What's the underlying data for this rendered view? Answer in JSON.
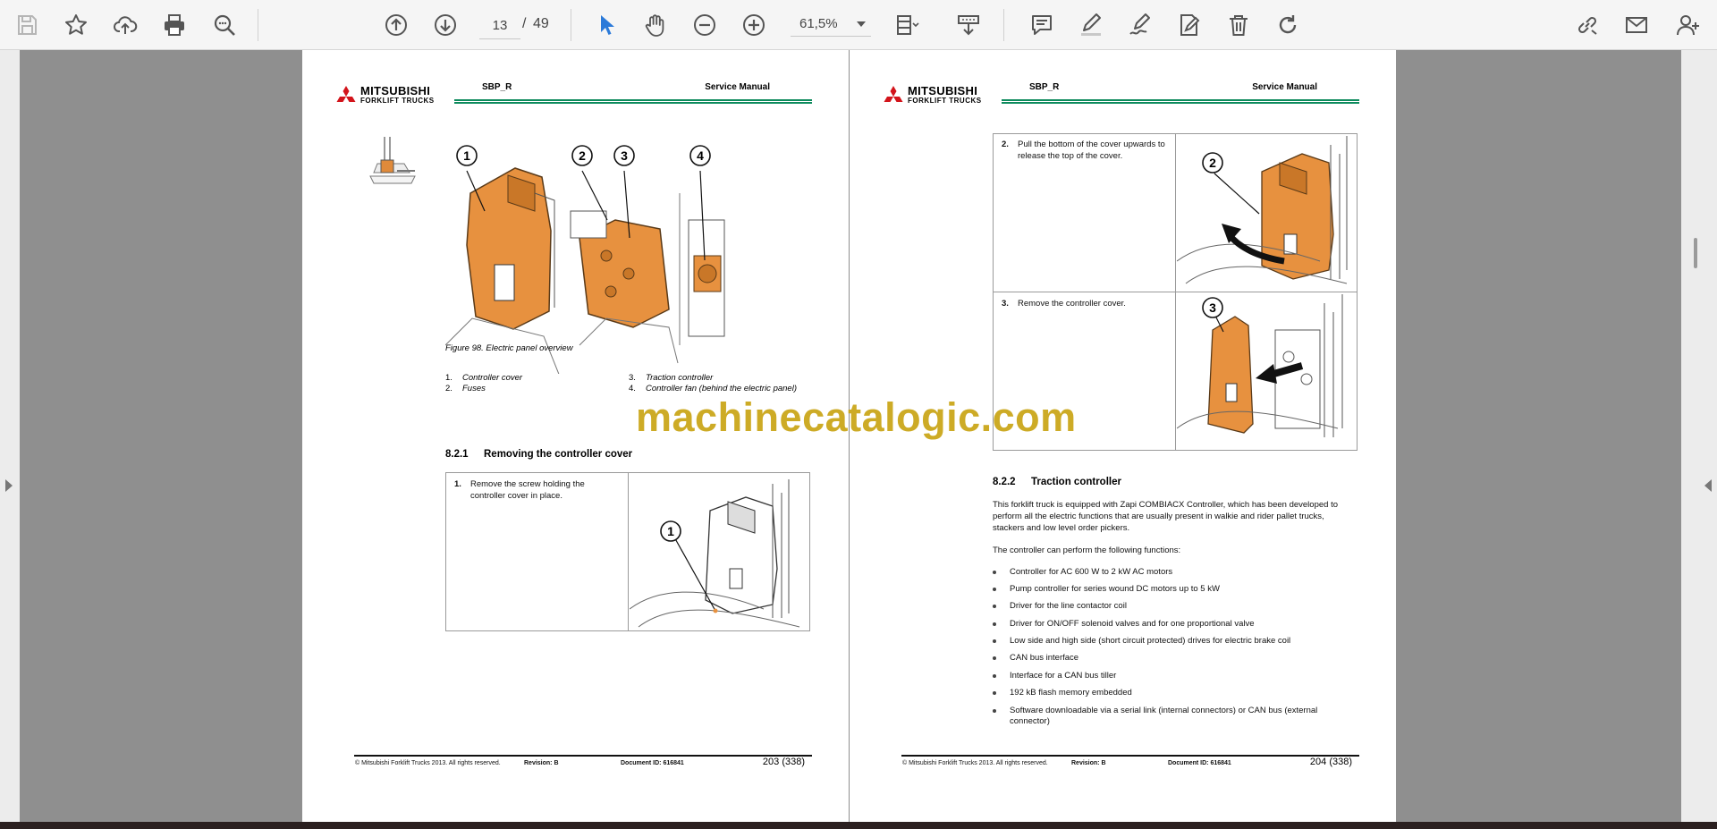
{
  "toolbar": {
    "page_current": "13",
    "page_separator": "/",
    "page_total": "49",
    "zoom": "61,5%",
    "icons": [
      "save-icon",
      "bookmark-star-icon",
      "upload-cloud-icon",
      "print-icon",
      "zoom-search-icon",
      "page-up-icon",
      "page-down-icon",
      "select-cursor-icon",
      "hand-tool-icon",
      "zoom-out-icon",
      "zoom-in-icon",
      "fit-page-icon",
      "scroll-mode-icon",
      "comment-icon",
      "highlight-pen-icon",
      "draw-icon",
      "fill-sign-icon",
      "delete-icon",
      "redo-icon",
      "share-link-icon",
      "email-icon",
      "add-user-icon"
    ],
    "accent": "#2b7ad9"
  },
  "watermark": "machinecatalogic.com",
  "page1": {
    "header": {
      "brand": "MITSUBISHI",
      "brand_sub": "FORKLIFT TRUCKS",
      "doc": "SBP_R",
      "manual": "Service Manual"
    },
    "figure_caption": "Figure 98. Electric panel overview",
    "callouts": [
      "1",
      "2",
      "3",
      "4"
    ],
    "legend": [
      {
        "num": "1.",
        "text": "Controller cover"
      },
      {
        "num": "2.",
        "text": "Fuses"
      },
      {
        "num": "3.",
        "text": "Traction controller"
      },
      {
        "num": "4.",
        "text": "Controller fan (behind the electric panel)"
      }
    ],
    "section_num": "8.2.1",
    "section_title": "Removing the controller cover",
    "step": {
      "num": "1.",
      "text": "Remove the screw holding the controller cover in place.",
      "callout": "1"
    },
    "footer": {
      "copyright": "© Mitsubishi Forklift Trucks 2013. All rights reserved.",
      "revision": "Revision: B",
      "docid": "Document ID: 616841",
      "page": "203 (338)"
    }
  },
  "page2": {
    "header": {
      "brand": "MITSUBISHI",
      "brand_sub": "FORKLIFT TRUCKS",
      "doc": "SBP_R",
      "manual": "Service Manual"
    },
    "steps": [
      {
        "num": "2.",
        "text": "Pull the bottom of the cover upwards to release the top of the cover.",
        "callout": "2"
      },
      {
        "num": "3.",
        "text": "Remove the controller cover.",
        "callout": "3"
      }
    ],
    "section_num": "8.2.2",
    "section_title": "Traction controller",
    "para1": "This forklift truck is equipped with Zapi COMBIACX Controller, which has been developed to perform all the electric functions that are usually present in walkie and rider pallet trucks, stackers and low level order pickers.",
    "para2": "The controller can perform the following functions:",
    "bullets": [
      "Controller for AC 600 W to 2 kW AC motors",
      "Pump controller for series wound DC motors up to 5 kW",
      "Driver for the line contactor coil",
      "Driver for ON/OFF solenoid valves and for one proportional valve",
      "Low side and high side (short circuit protected) drives for electric brake coil",
      "CAN bus interface",
      "Interface for a CAN bus tiller",
      "192 kB flash memory embedded",
      "Software downloadable via a serial link (internal connectors) or CAN bus (external connector)"
    ],
    "footer": {
      "copyright": "© Mitsubishi Forklift Trucks 2013. All rights reserved.",
      "revision": "Revision: B",
      "docid": "Document ID: 616841",
      "page": "204 (338)"
    }
  }
}
